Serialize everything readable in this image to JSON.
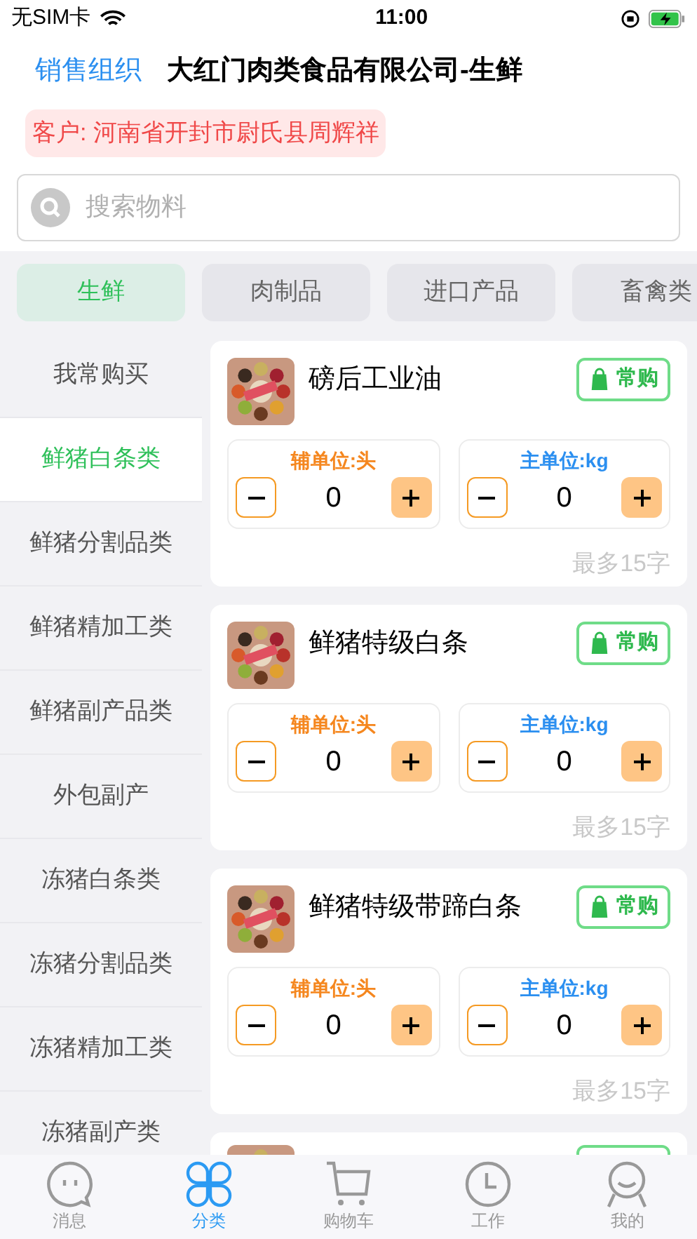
{
  "status_bar": {
    "carrier": "无SIM卡",
    "time": "11:00"
  },
  "header": {
    "label": "销售组织",
    "title": "大红门肉类食品有限公司-生鲜"
  },
  "customer": "客户: 河南省开封市尉氏县周辉祥",
  "search": {
    "placeholder": "搜索物料"
  },
  "category_tabs": [
    {
      "label": "生鲜",
      "selected": true
    },
    {
      "label": "肉制品",
      "selected": false
    },
    {
      "label": "进口产品",
      "selected": false
    },
    {
      "label": "畜禽类",
      "selected": false
    }
  ],
  "sidebar": {
    "items": [
      {
        "label": "我常购买",
        "selected": false
      },
      {
        "label": "鲜猪白条类",
        "selected": true
      },
      {
        "label": "鲜猪分割品类",
        "selected": false
      },
      {
        "label": "鲜猪精加工类",
        "selected": false
      },
      {
        "label": "鲜猪副产品类",
        "selected": false
      },
      {
        "label": "外包副产",
        "selected": false
      },
      {
        "label": "冻猪白条类",
        "selected": false
      },
      {
        "label": "冻猪分割品类",
        "selected": false
      },
      {
        "label": "冻猪精加工类",
        "selected": false
      },
      {
        "label": "冻猪副产类",
        "selected": false
      }
    ]
  },
  "products": [
    {
      "kind": "full",
      "name": "磅后工业油",
      "button": "常购",
      "aux_unit": "辅单位:头",
      "aux_qty": "0",
      "main_unit": "主单位:kg",
      "main_qty": "0",
      "note": "最多15字"
    },
    {
      "kind": "full",
      "name": "鲜猪特级白条",
      "button": "常购",
      "aux_unit": "辅单位:头",
      "aux_qty": "0",
      "main_unit": "主单位:kg",
      "main_qty": "0",
      "note": "最多15字"
    },
    {
      "kind": "full",
      "name": "鲜猪特级带蹄白条",
      "button": "常购",
      "aux_unit": "辅单位:头",
      "aux_qty": "0",
      "main_unit": "主单位:kg",
      "main_qty": "0",
      "note": "最多15字"
    },
    {
      "kind": "partial"
    }
  ],
  "tab_bar": [
    {
      "label": "消息",
      "selected": false
    },
    {
      "label": "分类",
      "selected": true
    },
    {
      "label": "购物车",
      "selected": false
    },
    {
      "label": "工作",
      "selected": false
    },
    {
      "label": "我的",
      "selected": false
    }
  ]
}
